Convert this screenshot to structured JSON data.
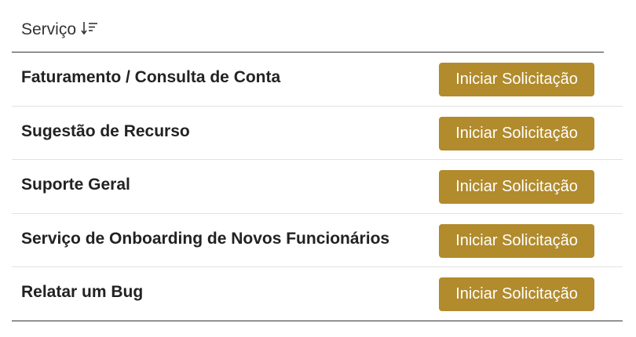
{
  "header": {
    "column_label": "Serviço",
    "sort_icon": "sort-descending-icon"
  },
  "colors": {
    "button_bg": "#b18b2c",
    "button_text": "#ffffff"
  },
  "rows": [
    {
      "title": "Faturamento / Consulta de Conta",
      "button_label": "Iniciar Solicitação"
    },
    {
      "title": "Sugestão de Recurso",
      "button_label": "Iniciar Solicitação"
    },
    {
      "title": "Suporte Geral",
      "button_label": "Iniciar Solicitação"
    },
    {
      "title": "Serviço de Onboarding de Novos Funcionários",
      "button_label": "Iniciar Solicitação"
    },
    {
      "title": "Relatar um Bug",
      "button_label": "Iniciar Solicitação"
    }
  ]
}
